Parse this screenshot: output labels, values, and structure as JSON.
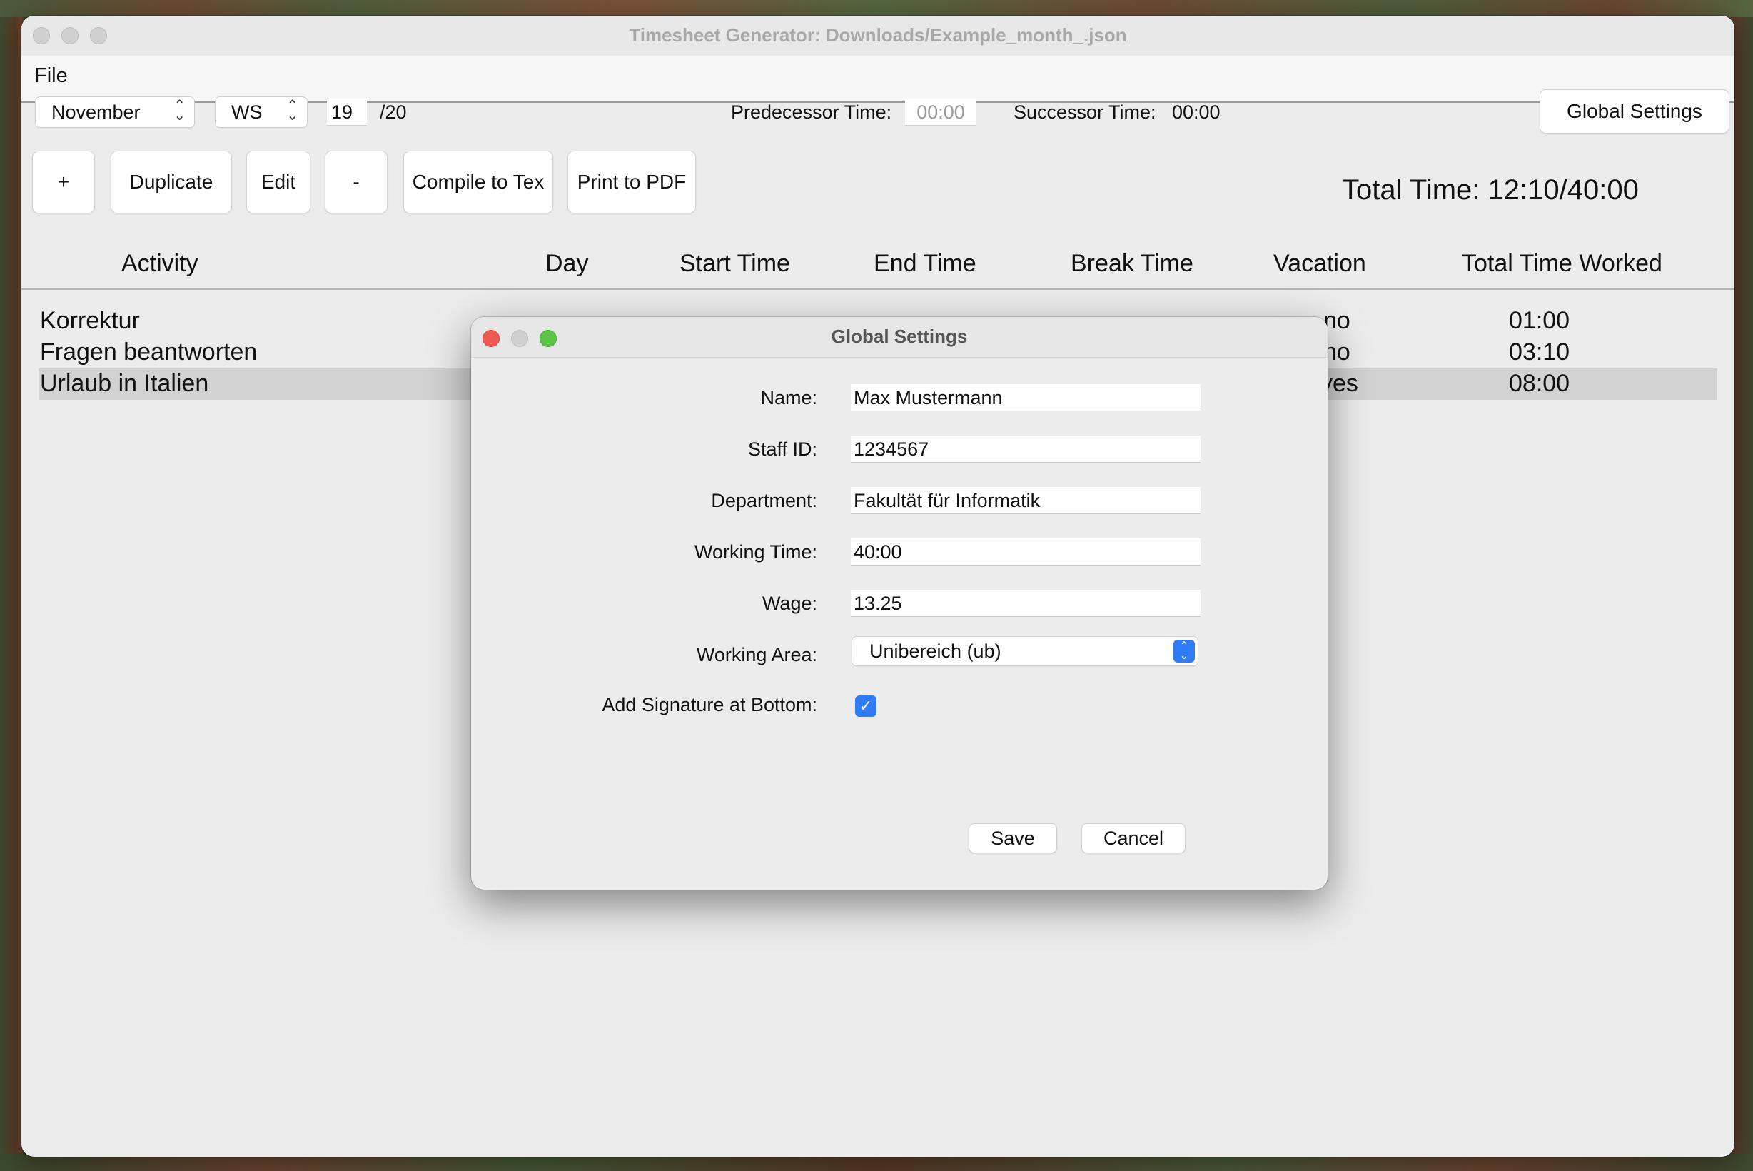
{
  "window": {
    "title": "Timesheet Generator: Downloads/Example_month_.json"
  },
  "menu": {
    "file": "File"
  },
  "toolbar": {
    "month": "November",
    "semester": "WS",
    "year": "19",
    "year_suffix": "/20",
    "predecessor_label": "Predecessor Time:",
    "predecessor_value": "00:00",
    "successor_label": "Successor Time:",
    "successor_value": "00:00",
    "global_settings": "Global Settings"
  },
  "actions": {
    "add": "+",
    "duplicate": "Duplicate",
    "edit": "Edit",
    "remove": "-",
    "compile": "Compile to Tex",
    "print": "Print to PDF"
  },
  "total_time": "Total Time: 12:10/40:00",
  "table": {
    "columns": [
      "Activity",
      "Day",
      "Start Time",
      "End Time",
      "Break Time",
      "Vacation",
      "Total Time Worked"
    ],
    "rows": [
      {
        "activity": "Korrektur",
        "vacation": "no",
        "total": "01:00"
      },
      {
        "activity": "Fragen beantworten",
        "vacation": "no",
        "total": "03:10"
      },
      {
        "activity": "Urlaub in Italien",
        "vacation": "yes",
        "total": "08:00"
      }
    ]
  },
  "dialog": {
    "title": "Global Settings",
    "name_label": "Name:",
    "name_value": "Max Mustermann",
    "staff_label": "Staff ID:",
    "staff_value": "1234567",
    "department_label": "Department:",
    "department_value": "Fakultät für Informatik",
    "working_time_label": "Working Time:",
    "working_time_value": "40:00",
    "wage_label": "Wage:",
    "wage_value": "13.25",
    "working_area_label": "Working Area:",
    "working_area_value": "Unibereich (ub)",
    "signature_label": "Add Signature at Bottom:",
    "signature_checked": true,
    "save": "Save",
    "cancel": "Cancel"
  }
}
